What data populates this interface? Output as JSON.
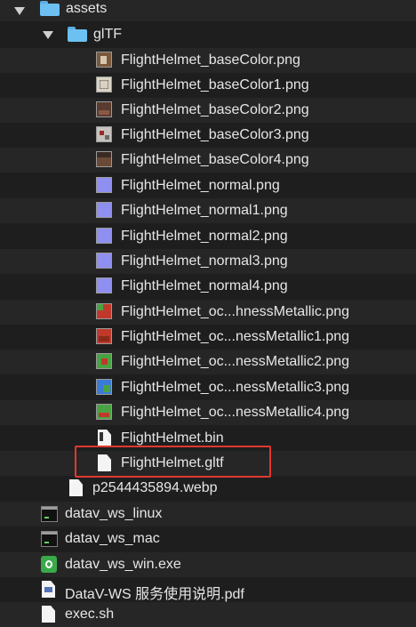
{
  "tree": {
    "assets": {
      "label": "assets",
      "icon": "folder-icon",
      "expanded": true
    },
    "gltf": {
      "label": "glTF",
      "icon": "folder-icon",
      "expanded": true
    },
    "gltf_files": [
      {
        "label": "FlightHelmet_baseColor.png",
        "thumb": "#7a5a3a",
        "thumb_accent": "#d8c8b0"
      },
      {
        "label": "FlightHelmet_baseColor1.png",
        "thumb": "#d9d2c4",
        "thumb_accent": "#8a8070"
      },
      {
        "label": "FlightHelmet_baseColor2.png",
        "thumb": "#5b3b2f",
        "thumb_accent": "#8a5a46"
      },
      {
        "label": "FlightHelmet_baseColor3.png",
        "thumb": "#c7c2bd",
        "thumb_accent": "#9c2a2a"
      },
      {
        "label": "FlightHelmet_baseColor4.png",
        "thumb": "#6a4a36",
        "thumb_accent": "#3a2a22"
      },
      {
        "label": "FlightHelmet_normal.png",
        "thumb": "#8f8ff0",
        "thumb_accent": "#8f8ff0"
      },
      {
        "label": "FlightHelmet_normal1.png",
        "thumb": "#8f8ff0",
        "thumb_accent": "#8f8ff0"
      },
      {
        "label": "FlightHelmet_normal2.png",
        "thumb": "#8f8ff0",
        "thumb_accent": "#8f8ff0"
      },
      {
        "label": "FlightHelmet_normal3.png",
        "thumb": "#8f8ff0",
        "thumb_accent": "#8f8ff0"
      },
      {
        "label": "FlightHelmet_normal4.png",
        "thumb": "#8f8ff0",
        "thumb_accent": "#8f8ff0"
      },
      {
        "label": "FlightHelmet_oc...hnessMetallic.png",
        "thumb": "#c0392b",
        "thumb_accent": "#4aa342"
      },
      {
        "label": "FlightHelmet_oc...nessMetallic1.png",
        "thumb": "#c0392b",
        "thumb_accent": "#8a2a1a"
      },
      {
        "label": "FlightHelmet_oc...nessMetallic2.png",
        "thumb": "#4aa342",
        "thumb_accent": "#c0392b"
      },
      {
        "label": "FlightHelmet_oc...nessMetallic3.png",
        "thumb": "#3a7bd5",
        "thumb_accent": "#4aa342"
      },
      {
        "label": "FlightHelmet_oc...nessMetallic4.png",
        "thumb": "#4aa342",
        "thumb_accent": "#c0392b"
      },
      {
        "label": "FlightHelmet.bin",
        "icon": "binary-file-icon"
      },
      {
        "label": "FlightHelmet.gltf",
        "icon": "document-icon",
        "highlighted": true
      }
    ],
    "assets_files": [
      {
        "label": "p2544435894.webp",
        "icon": "document-icon"
      }
    ],
    "root_files": [
      {
        "label": "datav_ws_linux",
        "icon": "terminal-icon"
      },
      {
        "label": "datav_ws_mac",
        "icon": "terminal-icon"
      },
      {
        "label": "datav_ws_win.exe",
        "icon": "exe-icon"
      },
      {
        "label": "DataV-WS 服务使用说明.pdf",
        "icon": "pdf-icon"
      },
      {
        "label": "exec.sh",
        "icon": "document-icon"
      }
    ]
  },
  "colors": {
    "highlight_border": "#e0382f",
    "folder": "#6cc0f2",
    "background": "#1e1e1e"
  }
}
